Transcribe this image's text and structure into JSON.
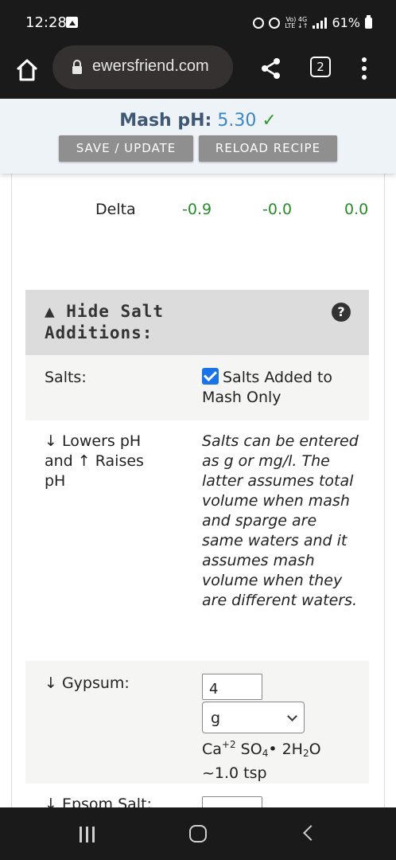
{
  "status_bar": {
    "time": "12:28",
    "net_top": "Vo) 4G",
    "net_bottom": "LTE ↓↑",
    "battery": "61%"
  },
  "browser": {
    "url": "ewersfriend.com",
    "tab_count": "2"
  },
  "header": {
    "ph_label": "Mash pH:",
    "ph_value": "5.30",
    "ph_check": "✓",
    "save_label": "SAVE / UPDATE",
    "reload_label": "RELOAD RECIPE"
  },
  "delta": {
    "label": "Delta",
    "values": [
      "-0.9",
      "-0.0",
      "0.0"
    ]
  },
  "salt_section": {
    "title": "▲ Hide  Salt Additions:",
    "help": "?",
    "salts_label": "Salts:",
    "checkbox_label": "Salts Added to Mash Only",
    "checkbox_checked": true,
    "info_label": "↓ Lowers pH and ↑ Raises pH",
    "info_note": "Salts can be entered as g or mg/l. The latter assumes total volume when mash and sparge are same waters and it assumes mash volume when they are different waters.",
    "gypsum": {
      "label": "↓ Gypsum:",
      "amount": "4",
      "unit": "g",
      "formula_ca": "Ca",
      "formula_charge": "+2",
      "formula_so": "SO",
      "formula_4": "4",
      "formula_rest": "• 2H",
      "formula_2": "2",
      "formula_o": "O",
      "tsp": "~1.0 tsp"
    },
    "epsom": {
      "label": "↓ Epsom Salt:"
    }
  }
}
